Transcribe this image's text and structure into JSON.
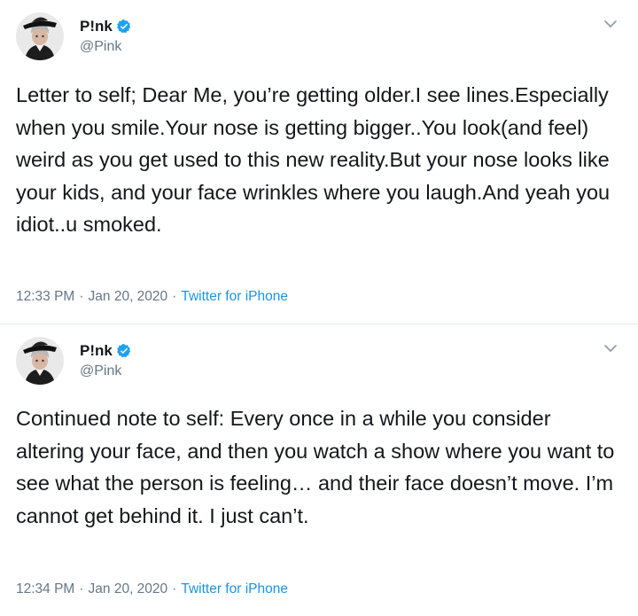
{
  "tweets": [
    {
      "user": {
        "display_name": "P!nk",
        "handle": "@Pink",
        "verified": true,
        "avatar_icon": "avatar-photo-hat"
      },
      "text": "Letter to self; Dear Me, you’re getting older.I see lines.Especially when you smile.Your nose is getting bigger..You look(and feel) weird as you get used to this new reality.But your nose looks like your kids, and your face wrinkles where you laugh.And yeah you idiot..u smoked.",
      "time": "12:33 PM",
      "date": "Jan 20, 2020",
      "source": "Twitter for iPhone",
      "separator": "·"
    },
    {
      "user": {
        "display_name": "P!nk",
        "handle": "@Pink",
        "verified": true,
        "avatar_icon": "avatar-photo-hat"
      },
      "text": "Continued note to self: Every once in a while you consider altering your face, and then you watch a show where you want to see what the person is feeling… and their face doesn’t move. I’m cannot get behind it. I just can’t.",
      "time": "12:34 PM",
      "date": "Jan 20, 2020",
      "source": "Twitter for iPhone",
      "separator": "·"
    }
  ],
  "colors": {
    "text": "#14171a",
    "muted": "#657786",
    "link": "#1b95e0",
    "verified": "#1da1f2",
    "divider": "#e6ecf0"
  }
}
